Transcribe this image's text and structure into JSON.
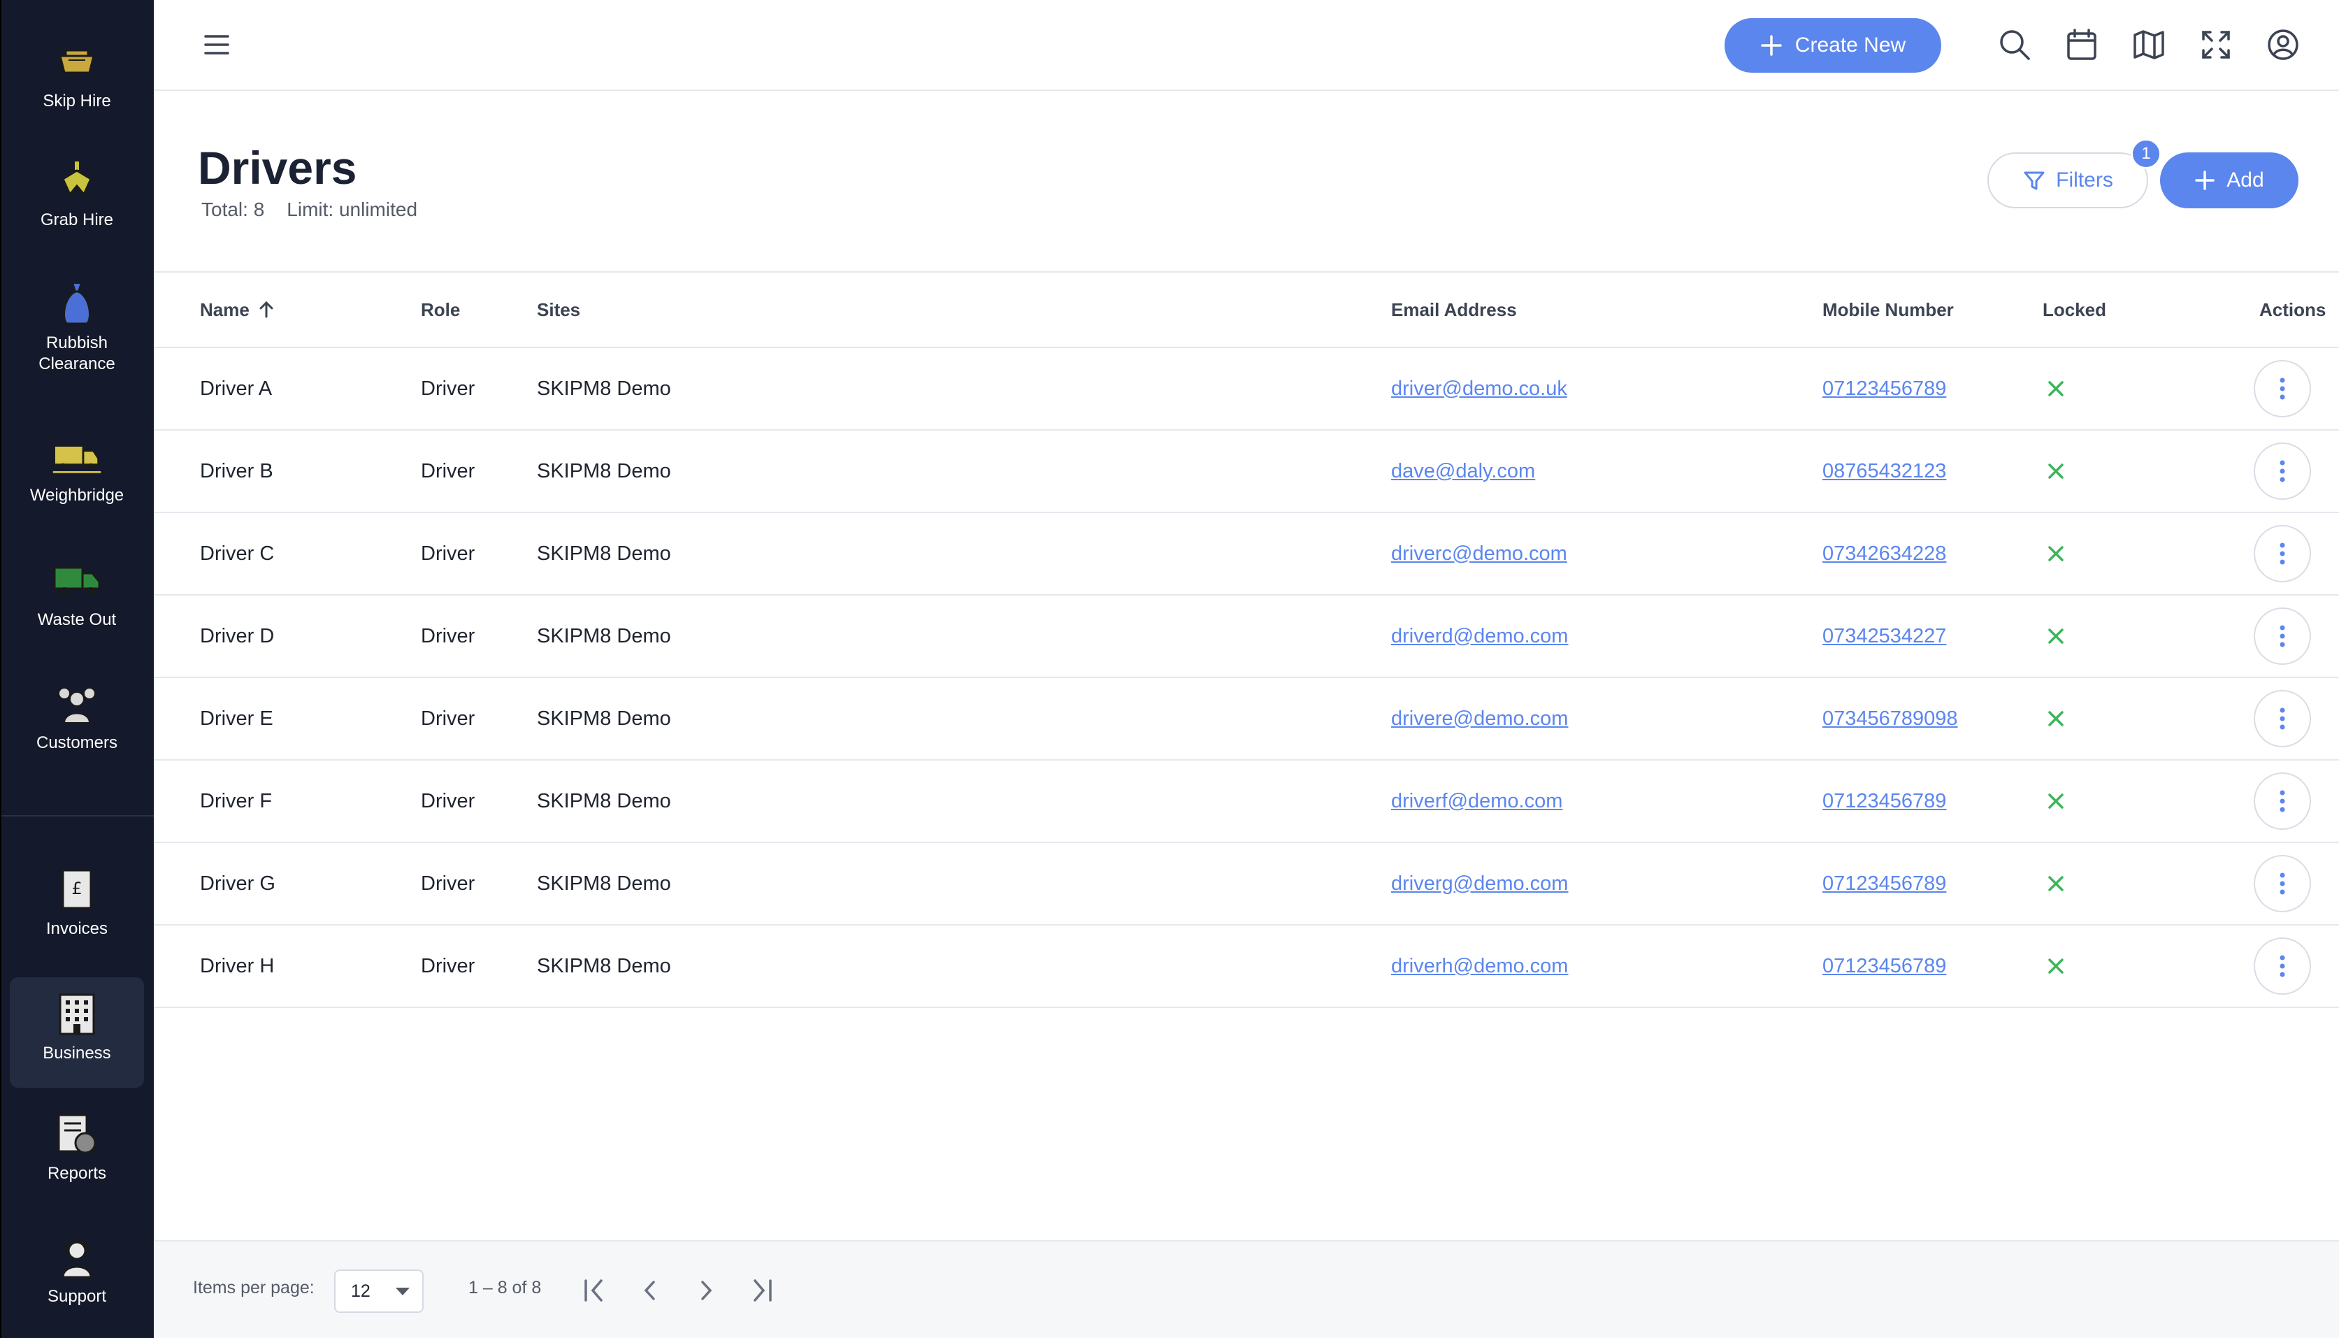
{
  "sidebar": {
    "items": [
      {
        "label": "Skip Hire",
        "icon": "skip-icon"
      },
      {
        "label": "Grab Hire",
        "icon": "grab-icon"
      },
      {
        "label": "Rubbish\nClearance",
        "icon": "rubbish-bag-icon"
      },
      {
        "label": "Weighbridge",
        "icon": "weighbridge-truck-icon"
      },
      {
        "label": "Waste Out",
        "icon": "waste-out-truck-icon"
      },
      {
        "label": "Customers",
        "icon": "customers-icon"
      },
      {
        "label": "Invoices",
        "icon": "invoice-icon"
      },
      {
        "label": "Business",
        "icon": "building-icon",
        "active": true
      },
      {
        "label": "Reports",
        "icon": "reports-icon"
      },
      {
        "label": "Support",
        "icon": "support-icon"
      }
    ]
  },
  "topbar": {
    "create_label": "Create New",
    "icons": [
      "search-icon",
      "calendar-icon",
      "map-icon",
      "fullscreen-icon",
      "account-icon"
    ]
  },
  "page": {
    "title": "Drivers",
    "total": "Total: 8",
    "limit": "Limit: unlimited",
    "filters_label": "Filters",
    "filter_count": "1",
    "add_label": "Add"
  },
  "table": {
    "headers": {
      "name": "Name",
      "role": "Role",
      "sites": "Sites",
      "email": "Email Address",
      "mobile": "Mobile Number",
      "locked": "Locked",
      "actions": "Actions"
    },
    "rows": [
      {
        "name": "Driver A",
        "role": "Driver",
        "sites": "SKIPM8 Demo",
        "email": "driver@demo.co.uk",
        "mobile": "07123456789",
        "locked": false
      },
      {
        "name": "Driver B",
        "role": "Driver",
        "sites": "SKIPM8 Demo",
        "email": "dave@daly.com",
        "mobile": "08765432123",
        "locked": false
      },
      {
        "name": "Driver C",
        "role": "Driver",
        "sites": "SKIPM8 Demo",
        "email": "driverc@demo.com",
        "mobile": "07342634228",
        "locked": false
      },
      {
        "name": "Driver D",
        "role": "Driver",
        "sites": "SKIPM8 Demo",
        "email": "driverd@demo.com",
        "mobile": "07342534227",
        "locked": false
      },
      {
        "name": "Driver E",
        "role": "Driver",
        "sites": "SKIPM8 Demo",
        "email": "drivere@demo.com",
        "mobile": "073456789098",
        "locked": false
      },
      {
        "name": "Driver F",
        "role": "Driver",
        "sites": "SKIPM8 Demo",
        "email": "driverf@demo.com",
        "mobile": "07123456789",
        "locked": false
      },
      {
        "name": "Driver G",
        "role": "Driver",
        "sites": "SKIPM8 Demo",
        "email": "driverg@demo.com",
        "mobile": "07123456789",
        "locked": false
      },
      {
        "name": "Driver H",
        "role": "Driver",
        "sites": "SKIPM8 Demo",
        "email": "driverh@demo.com",
        "mobile": "07123456789",
        "locked": false
      }
    ]
  },
  "pagination": {
    "items_per_page_label": "Items per page:",
    "items_per_page": "12",
    "range": "1 – 8 of 8"
  },
  "colors": {
    "accent": "#5b86ee",
    "sidebar_bg": "#141a2b",
    "locked_false": "#3cb55a"
  }
}
